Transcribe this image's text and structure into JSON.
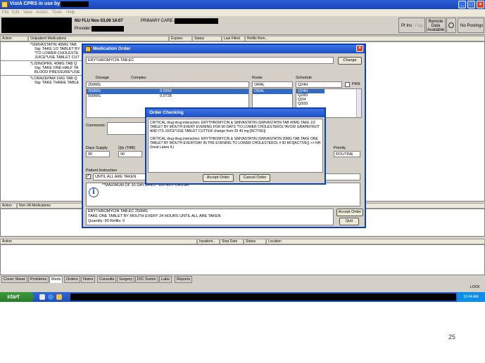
{
  "window": {
    "title": "VistA CPRS in use by:"
  },
  "menu": [
    "File",
    "Edit",
    "View",
    "Action",
    "Tools",
    "Help"
  ],
  "patient_header": {
    "location": "NU FLU Nov 03,06 14:07",
    "provider_label": "Provider:",
    "team": "PRIMARY CARE /",
    "pt_ins_label": "Pt Ins",
    "flag_label": "Flag",
    "remote_data": "Remote Data Available",
    "postings": "No Postings"
  },
  "outpatient": {
    "columns": [
      "Action",
      "Outpatient Medications",
      "Expires",
      "Status",
      "Last Filled",
      "Refills Rem..."
    ],
    "lines": [
      "*SIMVASTATIN 40MG TAB",
      "Sig: TAKE 1/2 TABLET BY",
      "*TO LOWER  CHOLESTE",
      "JUICE*USE TABLET CUT",
      "*LISINOPRIL 40MG TAB  Q",
      "Sig: TAKE ONE-HALF TA",
      "BLOOD PRESSURE*USE",
      "*LORAZEPAM 1MG TAB  Q",
      "Sig: TAKE THREE TABLE"
    ]
  },
  "med_order": {
    "title": "Medication Order",
    "drug": "ERYTHROMYCIN TAB,EC",
    "change_label": "Change",
    "tab_dosage": "Dosage",
    "tab_complex": "Complex",
    "dosage_value": "250MG",
    "dosages": [
      {
        "dose": "250MG",
        "cost": "0.0264"
      },
      {
        "dose": "500MG",
        "cost": "0.0728"
      }
    ],
    "route_label": "Route",
    "route_value": "ORAL",
    "route_selected": "ORAL",
    "schedule_label": "Schedule",
    "schedule_value": "Q24H",
    "prn_label": "PRN",
    "schedules": [
      "Q24H",
      "Q28D",
      "Q2H",
      "Q30D"
    ],
    "comments_label": "Comments:",
    "days_supply_label": "Days Supply",
    "days_supply_value": "90",
    "qty_label": "Qty (TAB)",
    "qty_value": "90",
    "priority_label": "Priority",
    "priority_value": "ROUTINE",
    "patient_instruction_label": "Patient Instruction",
    "patient_instruction_value": "UNTIL ALL ARE TAKEN",
    "info_text": "**MAXIMUM OF 30 DAYS/FILL**DO NOT CRUSH**",
    "summary_line1": "ERYTHROMYCIN TAB,EC  250MG",
    "summary_line2": "TAKE ONE TABLET BY MOUTH EVERY 24 HOURS UNTIL ALL ARE TAKEN",
    "summary_line3": "Quantity: 90 Refills: 0",
    "accept_label": "Accept Order",
    "quit_label": "Quit"
  },
  "order_checking": {
    "title": "Order Checking",
    "msg1": "CRITICAL drug-drug interaction: ERYTHROMYCIN & SIMVASTATIN (SIMVASTATIN TAB  40MG TAKE 1/2 TABLET BY MOUTH EVERY EVENING FOR 90 DAYS *TO LOWER CHOLESTEROL*AVOID GRAPEFRUIT AND ITS JUICE*USE TABLET CUTTER change from 20 40 mg    [ACTIVE])",
    "msg2": "CRITICAL drug-drug interaction: ERYTHROMYCIN & SIMVASTATIN (SIMVASTATIN 20MG TAB TAKE ONE TABLET BY MOUTH EVERYDAY IN THE EVENING TO LOWER CHOLESTEROL # 90 RF3[ACTIVE]) >> NH Great Lakes IL)",
    "accept_label": "Accept Order",
    "cancel_label": "Cancel Order"
  },
  "nonva": {
    "columns": [
      "Action",
      "Non-VA Medications"
    ]
  },
  "inpatient": {
    "columns": [
      "Action",
      "Inpatient...",
      "Stop Date",
      "Status",
      "Location"
    ]
  },
  "tabs": [
    "Cover Sheet",
    "Problems",
    "Meds",
    "Orders",
    "Notes",
    "Consults",
    "Surgery",
    "D/C Summ",
    "Labs",
    "Reports"
  ],
  "active_tab": "Meds",
  "status": {
    "lock": "LOCK"
  },
  "taskbar": {
    "start": "start",
    "clock": "10:44 AM"
  },
  "page_number": "25"
}
